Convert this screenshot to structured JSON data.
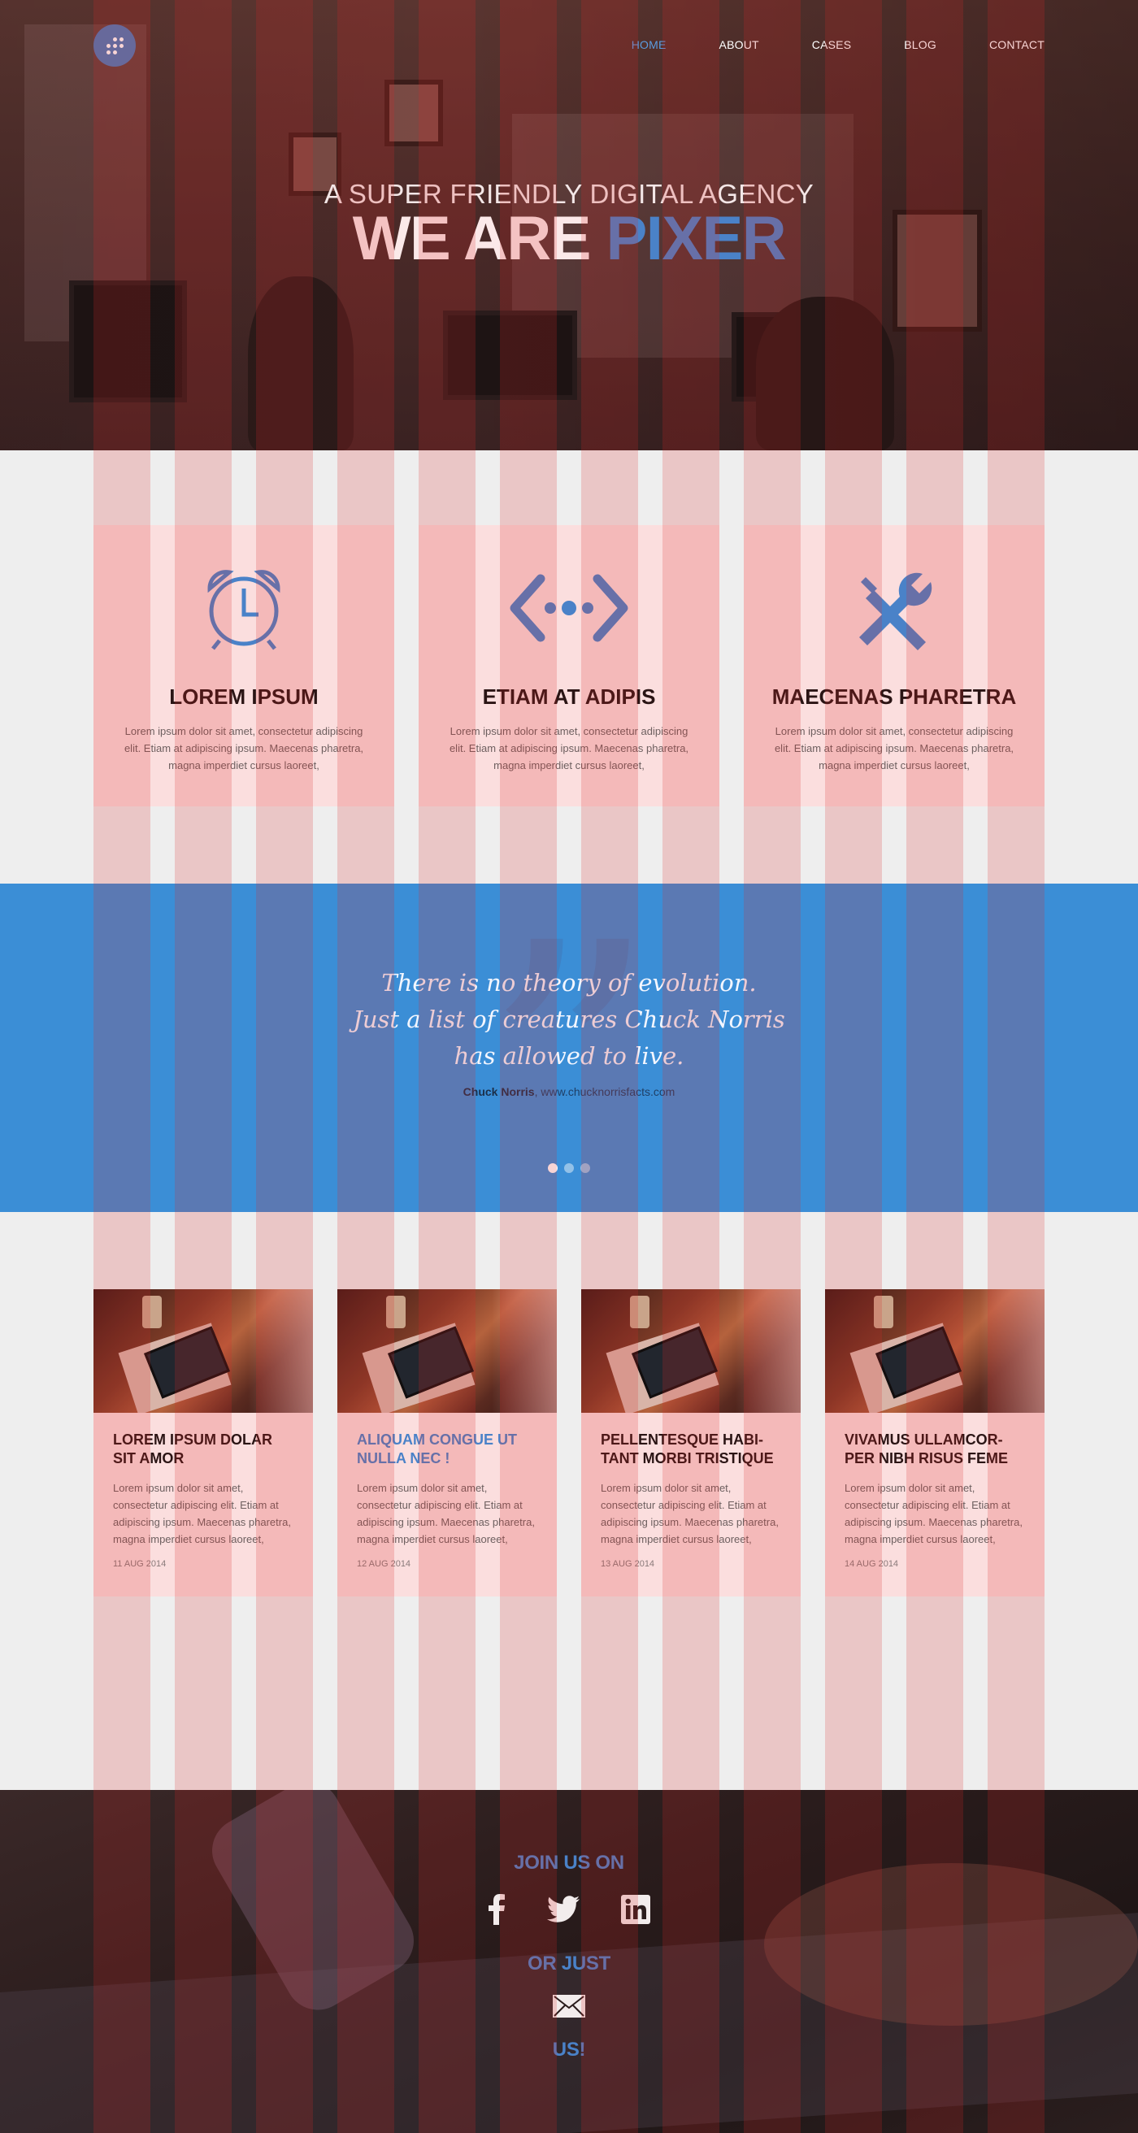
{
  "nav": {
    "items": [
      {
        "label": "HOME",
        "active": true
      },
      {
        "label": "ABOUT",
        "active": false
      },
      {
        "label": "CASES",
        "active": false
      },
      {
        "label": "BLOG",
        "active": false
      },
      {
        "label": "CONTACT",
        "active": false
      }
    ]
  },
  "hero": {
    "subtitle": "A SUPER FRIENDLY DIGITAL AGENCY",
    "title_main": "WE ARE",
    "title_accent": "PIXER"
  },
  "features": [
    {
      "icon": "alarm-clock-icon",
      "title": "LOREM IPSUM",
      "text": "Lorem ipsum dolor sit amet, consectetur adipiscing elit. Etiam at adipiscing ipsum. Maecenas pharetra, magna imperdiet cursus laoreet,"
    },
    {
      "icon": "code-brackets-icon",
      "title": "ETIAM AT ADIPIS",
      "text": "Lorem ipsum dolor sit amet, consectetur adipiscing elit. Etiam at adipiscing ipsum. Maecenas pharetra, magna imperdiet cursus laoreet,"
    },
    {
      "icon": "tools-icon",
      "title": "MAECENAS PHARETRA",
      "text": "Lorem ipsum dolor sit amet, consectetur adipiscing elit. Etiam at adipiscing ipsum. Maecenas pharetra, magna imperdiet cursus laoreet,"
    }
  ],
  "quote": {
    "lines": [
      "There is no theory of evolution.",
      "Just a list of creatures Chuck Norris",
      "has allowed to live."
    ],
    "author": "Chuck Norris",
    "source": ", www.chucknorrisfacts.com",
    "dots": 3,
    "active_dot": 0
  },
  "posts": [
    {
      "title": "LOREM IPSUM DOLAR SIT AMOR",
      "highlight": false,
      "text": "Lorem ipsum dolor sit amet, consectetur adipiscing elit. Etiam at adipiscing ipsum. Maecenas pharetra, magna imperdiet cursus laoreet,",
      "date": "11 AUG 2014"
    },
    {
      "title": "ALIQUAM CONGUE UT NULLA NEC !",
      "highlight": true,
      "text": "Lorem ipsum dolor sit amet, consectetur adipiscing elit. Etiam at adipiscing ipsum. Maecenas pharetra, magna imperdiet cursus laoreet,",
      "date": "12 AUG 2014"
    },
    {
      "title": "PELLENTESQUE HABI- TANT MORBI TRISTIQUE",
      "highlight": false,
      "text": "Lorem ipsum dolor sit amet, consectetur adipiscing elit. Etiam at adipiscing ipsum. Maecenas pharetra, magna imperdiet cursus laoreet,",
      "date": "13 AUG 2014"
    },
    {
      "title": "VIVAMUS ULLAMCOR- PER NIBH RISUS FEME",
      "highlight": false,
      "text": "Lorem ipsum dolor sit amet, consectetur adipiscing elit. Etiam at adipiscing ipsum. Maecenas pharetra, magna imperdiet cursus laoreet,",
      "date": "14 AUG 2014"
    }
  ],
  "footer": {
    "join": "JOIN US ON",
    "or_just": "OR JUST",
    "us": "US!",
    "social": [
      "facebook-icon",
      "twitter-icon",
      "linkedin-icon"
    ],
    "mail_icon": "envelope-icon"
  },
  "colors": {
    "accent": "#4a82c8",
    "quote_bg": "#3b8ed6",
    "card_bg": "#fbdede",
    "page_bg": "#eeeeee"
  }
}
